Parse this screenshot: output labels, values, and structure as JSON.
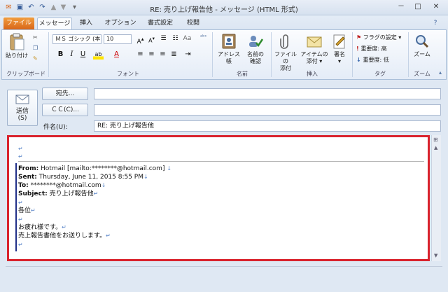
{
  "window": {
    "title": "RE: 売り上げ報告他 - メッセージ (HTML 形式)",
    "controls": [
      "－",
      "□",
      "✕"
    ]
  },
  "qat": {
    "help_glyph": "?"
  },
  "tabs": [
    {
      "label": "ファイル",
      "kind": "file"
    },
    {
      "label": "メッセージ",
      "kind": "active"
    },
    {
      "label": "挿入",
      "kind": "normal"
    },
    {
      "label": "オプション",
      "kind": "normal"
    },
    {
      "label": "書式設定",
      "kind": "normal"
    },
    {
      "label": "校閲",
      "kind": "normal"
    }
  ],
  "ribbon": {
    "clipboard": {
      "paste_label": "貼り付け",
      "group_label": "クリップボード"
    },
    "font": {
      "font_name": "ＭＳ ゴシック (本",
      "font_size": "10",
      "bold": "B",
      "italic": "I",
      "underline": "U",
      "font_color_glyph": "A",
      "group_label": "フォント"
    },
    "names": {
      "address_book_label": "アドレス帳",
      "check_names_label_1": "名前の",
      "check_names_label_2": "確認",
      "group_label": "名前"
    },
    "insert": {
      "attach_file_1": "ファイルの",
      "attach_file_2": "添付",
      "attach_item_1": "アイテムの",
      "attach_item_2": "添付 ▾",
      "signature_1": "署名",
      "signature_2": "▾",
      "group_label": "挿入"
    },
    "tags": {
      "follow_up": "フラグの設定 ▾",
      "high_importance": "重要度: 高",
      "low_importance": "重要度: 低",
      "group_label": "タグ"
    },
    "zoom": {
      "zoom_label": "ズーム",
      "group_label": "ズーム"
    }
  },
  "compose": {
    "send_label_1": "送信",
    "send_label_2": "(S)",
    "to_button": "宛先...",
    "cc_button": "ＣＣ(C)...",
    "subject_label": "件名(U):",
    "to_value": "",
    "cc_value": "",
    "subject_value": "RE: 売り上げ報告他"
  },
  "body": {
    "from_label": "From:",
    "from_value": " Hotmail [mailto:********@hotmail.com] ",
    "sent_label": "Sent:",
    "sent_value": " Thursday, June 11, 2015 8:55 PM",
    "to_label": "To:",
    "to_value": " ********@hotmail.com",
    "subject_label": "Subject:",
    "subject_value": " 売り上げ報告他",
    "greeting": "各位",
    "line1": "お疲れ様です。",
    "line2": "売上報告書他をお送りします。",
    "para_mark": "↵",
    "break_mark": "↓"
  }
}
